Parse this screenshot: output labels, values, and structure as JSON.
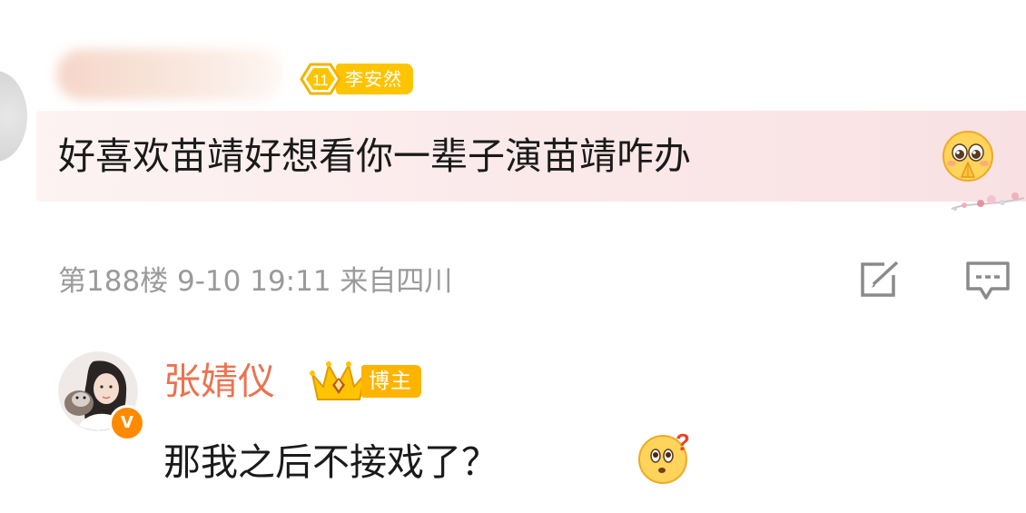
{
  "comment": {
    "user_level_icon": "level-11-icon",
    "level": "11",
    "level_badge_name": "李安然",
    "text": "好喜欢苗靖好想看你一辈子演苗靖咋办",
    "emoji": "pleading-face-icon",
    "meta": "第188楼 9-10 19:11 来自四川",
    "actions": {
      "edit_icon": "share-edit-icon",
      "reply_icon": "comment-reply-icon"
    }
  },
  "reply": {
    "username": "张婧仪",
    "verified_badge": "V",
    "role_badge": "博主",
    "role_icon": "crown-icon",
    "text": "那我之后不接戏了？",
    "emoji": "confused-face-icon"
  },
  "colors": {
    "username_orange": "#eb7350",
    "badge_yellow": "#ffc400",
    "meta_gray": "#9a9a9a",
    "bubble_pink": "#fbe9ea"
  }
}
